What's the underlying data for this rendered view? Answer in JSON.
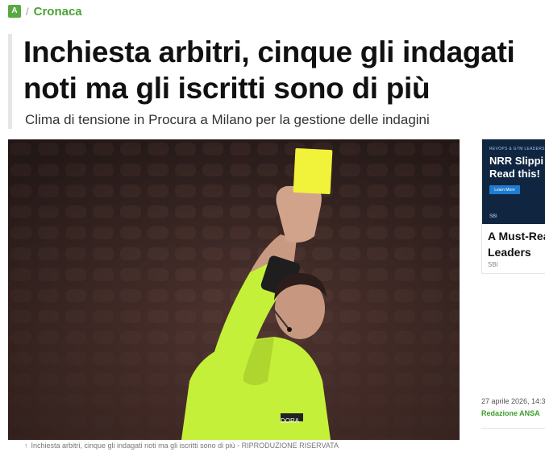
{
  "breadcrumb": {
    "logo": "A",
    "separator": "/",
    "section": "Cronaca"
  },
  "article": {
    "title_line1": "Inchiesta arbitri, cinque gli indagati",
    "title_line2": "noti ma gli iscritti sono di più",
    "subtitle": "Clima di tensione in Procura a Milano per la gestione delle indagini",
    "caption_arrow": "↑",
    "caption": "Inchiesta arbitri, cinque gli indagati noti ma gli iscritti sono di più - RIPRODUZIONE RISERVATA",
    "date": "27 aprile 2026, 14:3",
    "author": "Redazione ANSA"
  },
  "ad": {
    "kicker": "REVOPS & GTM LEADERS",
    "headline_line1": "NRR Slippi",
    "headline_line2": "Read this!",
    "cta": "Learn More",
    "brand": "SBI",
    "title_line1": "A Must-Rea",
    "title_line2": "Leaders",
    "source": "SBI"
  },
  "colors": {
    "accent_green": "#4aa336",
    "ad_navy": "#0f2540",
    "card_yellow": "#f1f23a",
    "kit_green": "#c4f03a"
  }
}
